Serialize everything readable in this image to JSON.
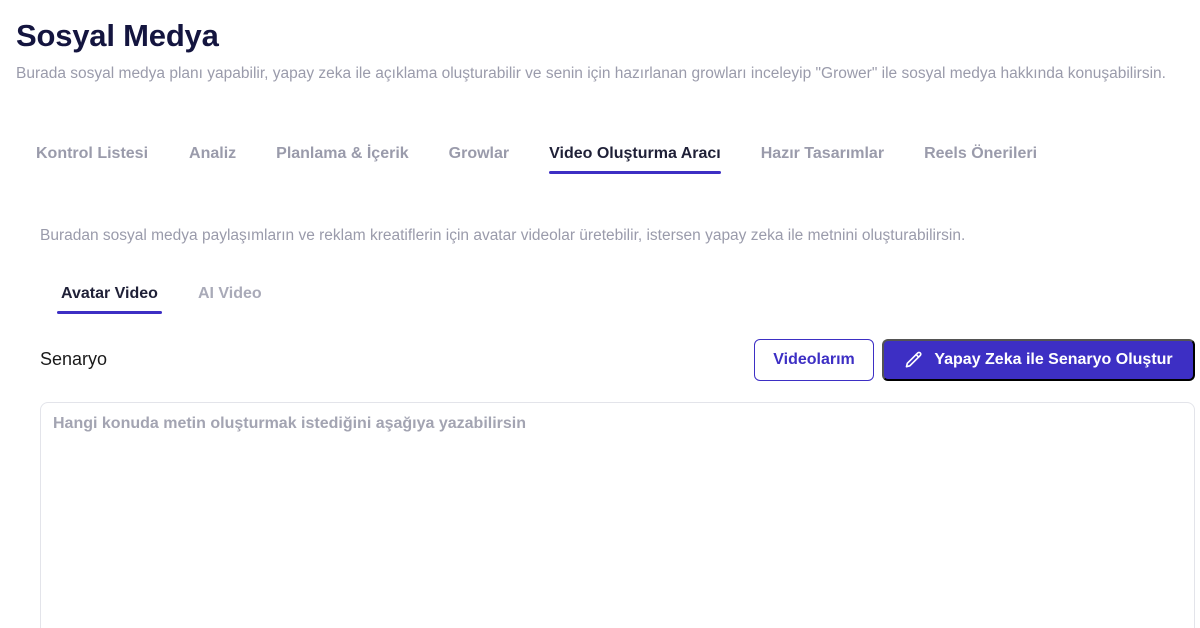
{
  "header": {
    "title": "Sosyal Medya",
    "description": "Burada sosyal medya planı yapabilir, yapay zeka ile açıklama oluşturabilir ve senin için hazırlanan growları inceleyip \"Grower\" ile sosyal medya hakkında konuşabilirsin."
  },
  "tabs": [
    {
      "label": "Kontrol Listesi",
      "active": false
    },
    {
      "label": "Analiz",
      "active": false
    },
    {
      "label": "Planlama & İçerik",
      "active": false
    },
    {
      "label": "Growlar",
      "active": false
    },
    {
      "label": "Video Oluşturma Aracı",
      "active": true
    },
    {
      "label": "Hazır Tasarımlar",
      "active": false
    },
    {
      "label": "Reels Önerileri",
      "active": false
    }
  ],
  "video_tool": {
    "intro": "Buradan sosyal medya paylaşımların ve reklam kreatiflerin için avatar videolar üretebilir, istersen yapay zeka ile metnini oluşturabilirsin.",
    "subtabs": [
      {
        "label": "Avatar Video",
        "active": true
      },
      {
        "label": "AI Video",
        "active": false
      }
    ],
    "section_label": "Senaryo",
    "videos_button": "Videolarım",
    "generate_button": "Yapay Zeka ile Senaryo Oluştur",
    "generate_icon": "pencil-icon",
    "textarea": {
      "value": "",
      "placeholder": "Hangi konuda metin oluşturmak istediğini aşağıya yazabilirsin"
    }
  },
  "colors": {
    "accent": "#3d2fc4",
    "title": "#14153f",
    "muted": "#9a9bab"
  }
}
